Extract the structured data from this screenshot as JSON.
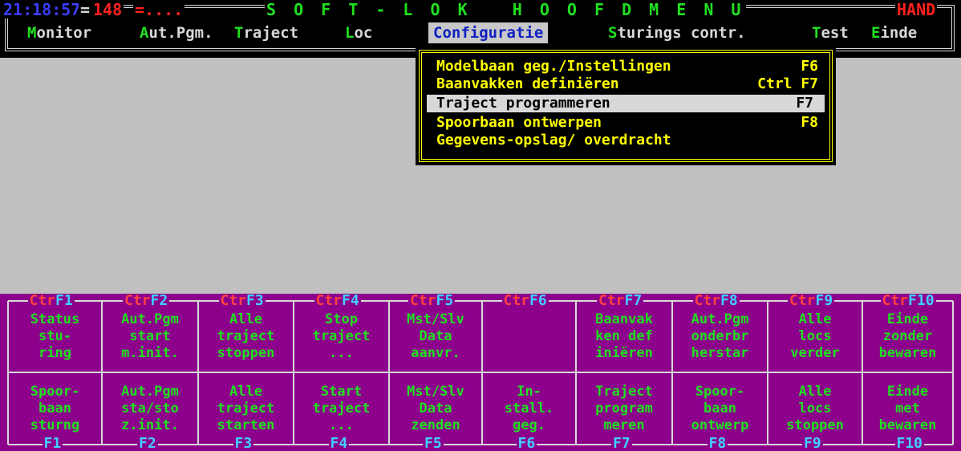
{
  "header": {
    "clock": "21:18:57",
    "separator": "=",
    "counter": "148",
    "dots": "=....",
    "app_title": "S O F T - L O K   H O O F D M E N U",
    "mode": "HAND"
  },
  "menubar": {
    "items": [
      {
        "hotkey": "M",
        "rest": "onitor"
      },
      {
        "hotkey": "A",
        "rest": "ut.Pgm."
      },
      {
        "hotkey": "T",
        "rest": "raject"
      },
      {
        "hotkey": "L",
        "rest": "oc"
      },
      {
        "hotkey": "C",
        "rest": "onfiguratie"
      },
      {
        "hotkey": "S",
        "rest": "turings contr."
      },
      {
        "hotkey": "T",
        "rest": "est"
      },
      {
        "hotkey": "E",
        "rest": "inde"
      }
    ],
    "active_index": 4
  },
  "dropdown": {
    "items": [
      {
        "label": "Modelbaan geg./Instellingen",
        "shortcut": "F6"
      },
      {
        "label": "Baanvakken definiëren",
        "shortcut": "Ctrl F7"
      },
      {
        "label": "Traject programmeren",
        "shortcut": "F7"
      },
      {
        "label": "Spoorbaan ontwerpen",
        "shortcut": "F8"
      },
      {
        "label": "Gegevens-opslag/ overdracht",
        "shortcut": ""
      }
    ],
    "selected_index": 2
  },
  "fkeys": {
    "ctrl_prefix": "Ctr",
    "top_labels": [
      "F1",
      "F2",
      "F3",
      "F4",
      "F5",
      "F6",
      "F7",
      "F8",
      "F9",
      "F10"
    ],
    "bottom_labels": [
      "F1",
      "F2",
      "F3",
      "F4",
      "F5",
      "F6",
      "F7",
      "F8",
      "F9",
      "F10"
    ],
    "ctrl_row": [
      [
        "Status",
        "stu-",
        "ring"
      ],
      [
        "Aut.Pgm",
        "start",
        "m.init."
      ],
      [
        "Alle",
        "traject",
        "stoppen"
      ],
      [
        "Stop",
        "traject",
        "..."
      ],
      [
        "Mst/Slv",
        "Data",
        "aanvr."
      ],
      [
        "",
        "",
        ""
      ],
      [
        "Baanvak",
        "ken def",
        "iniëren"
      ],
      [
        "Aut.Pgm",
        "onderbr",
        "herstar"
      ],
      [
        "Alle",
        "locs",
        "verder"
      ],
      [
        "Einde",
        "zonder",
        "bewaren"
      ]
    ],
    "fn_row": [
      [
        "Spoor-",
        "baan",
        "sturng"
      ],
      [
        "Aut.Pgm",
        "sta/sto",
        "z.init."
      ],
      [
        "Alle",
        "traject",
        "starten"
      ],
      [
        "Start",
        "traject",
        "..."
      ],
      [
        "Mst/Slv",
        "Data",
        "zenden"
      ],
      [
        "In-",
        "stall.",
        "geg."
      ],
      [
        "Traject",
        "program",
        "meren"
      ],
      [
        "Spoor-",
        "baan",
        "ontwerp"
      ],
      [
        "Alle",
        "locs",
        "stoppen"
      ],
      [
        "Einde",
        "met",
        "bewaren"
      ]
    ]
  }
}
